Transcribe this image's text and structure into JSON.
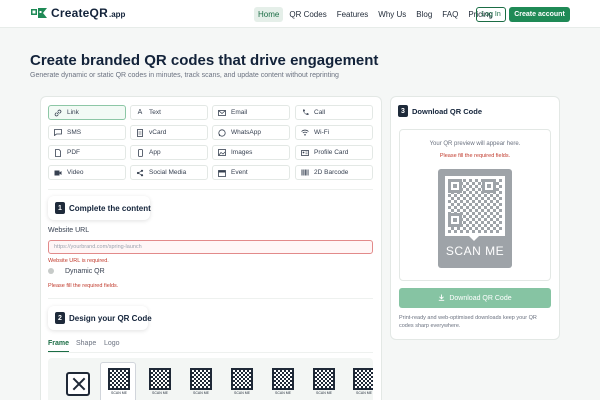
{
  "brand": {
    "name": "CreateQR",
    "suffix": ".app",
    "accent": "#1f8a56"
  },
  "nav": {
    "items": [
      "Home",
      "QR Codes",
      "Features",
      "Why Us",
      "Blog",
      "FAQ",
      "Pricing"
    ],
    "login": "Log In",
    "create_account": "Create account"
  },
  "hero": {
    "title": "Create branded QR codes that drive engagement",
    "subtitle": "Generate dynamic or static QR codes in minutes, track scans, and update content without reprinting"
  },
  "types": [
    {
      "label": "Link",
      "icon": "link-icon",
      "active": true
    },
    {
      "label": "Text",
      "icon": "text-icon"
    },
    {
      "label": "Email",
      "icon": "email-icon"
    },
    {
      "label": "Call",
      "icon": "phone-icon"
    },
    {
      "label": "SMS",
      "icon": "sms-icon"
    },
    {
      "label": "vCard",
      "icon": "vcard-icon"
    },
    {
      "label": "WhatsApp",
      "icon": "whatsapp-icon"
    },
    {
      "label": "Wi-Fi",
      "icon": "wifi-icon"
    },
    {
      "label": "PDF",
      "icon": "pdf-icon"
    },
    {
      "label": "App",
      "icon": "app-icon"
    },
    {
      "label": "Images",
      "icon": "image-icon"
    },
    {
      "label": "Profile Card",
      "icon": "profile-card-icon"
    },
    {
      "label": "Video",
      "icon": "video-icon"
    },
    {
      "label": "Social Media",
      "icon": "share-icon"
    },
    {
      "label": "Event",
      "icon": "calendar-icon"
    },
    {
      "label": "2D Barcode",
      "icon": "barcode-icon"
    }
  ],
  "step1": {
    "num": "1",
    "label": "Complete the content"
  },
  "website": {
    "label": "Website URL",
    "placeholder": "https://yourbrand.com/spring-launch",
    "error": "Website URL is required.",
    "dynamic_label": "Dynamic QR",
    "form_error": "Please fill the required fields."
  },
  "step2": {
    "num": "2",
    "label": "Design your QR Code"
  },
  "design_tabs": [
    "Frame",
    "Shape",
    "Logo"
  ],
  "frames": {
    "caption": "SCAN ME"
  },
  "download": {
    "num": "3",
    "label": "Download QR Code",
    "preview_text": "Your QR preview will appear here.",
    "preview_error": "Please fill the required fields.",
    "scan_me": "SCAN ME",
    "button": "Download QR Code",
    "note": "Print-ready and web-optimised downloads keep your QR codes sharp everywhere."
  }
}
